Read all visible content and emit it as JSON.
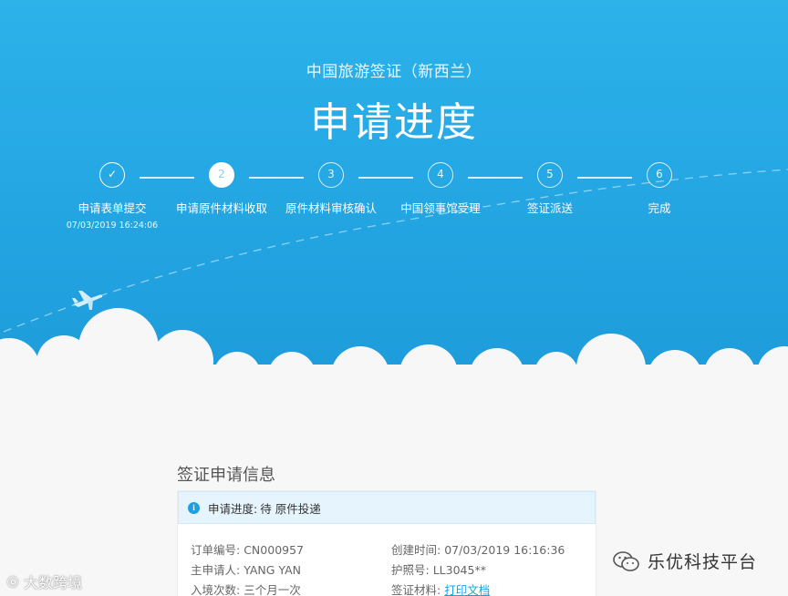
{
  "header": {
    "subtitle": "中国旅游签证（新西兰）",
    "title": "申请进度"
  },
  "steps": [
    {
      "marker": "✓",
      "label": "申请表单提交",
      "date": "07/03/2019 16:24:06",
      "state": "done"
    },
    {
      "marker": "2",
      "label": "申请原件材料收取",
      "date": "",
      "state": "active"
    },
    {
      "marker": "3",
      "label": "原件材料审核确认",
      "date": "",
      "state": "pending"
    },
    {
      "marker": "4",
      "label": "中国领事馆受理",
      "date": "",
      "state": "pending"
    },
    {
      "marker": "5",
      "label": "签证派送",
      "date": "",
      "state": "pending"
    },
    {
      "marker": "6",
      "label": "完成",
      "date": "",
      "state": "pending"
    }
  ],
  "section": {
    "title": "签证申请信息"
  },
  "status": {
    "icon": "info-icon",
    "label": "申请进度:",
    "value": "待 原件投递"
  },
  "info": {
    "order_label": "订单编号:",
    "order_value": "CN000957",
    "created_label": "创建时间:",
    "created_value": "07/03/2019 16:16:36",
    "applicant_label": "主申请人:",
    "applicant_value": "YANG YAN",
    "passport_label": "护照号:",
    "passport_value": "LL3045**",
    "entries_label": "入境次数:",
    "entries_value": "三个月一次",
    "materials_label": "签证材料:",
    "materials_link": "打印文档"
  },
  "watermarks": {
    "left_badge": "ⓒ",
    "left_text": "大数跨境",
    "right_text": "乐优科技平台"
  },
  "colors": {
    "hero": "#2db2ea",
    "accent": "#1e9fe3",
    "status_bg": "#e6f5fd"
  }
}
